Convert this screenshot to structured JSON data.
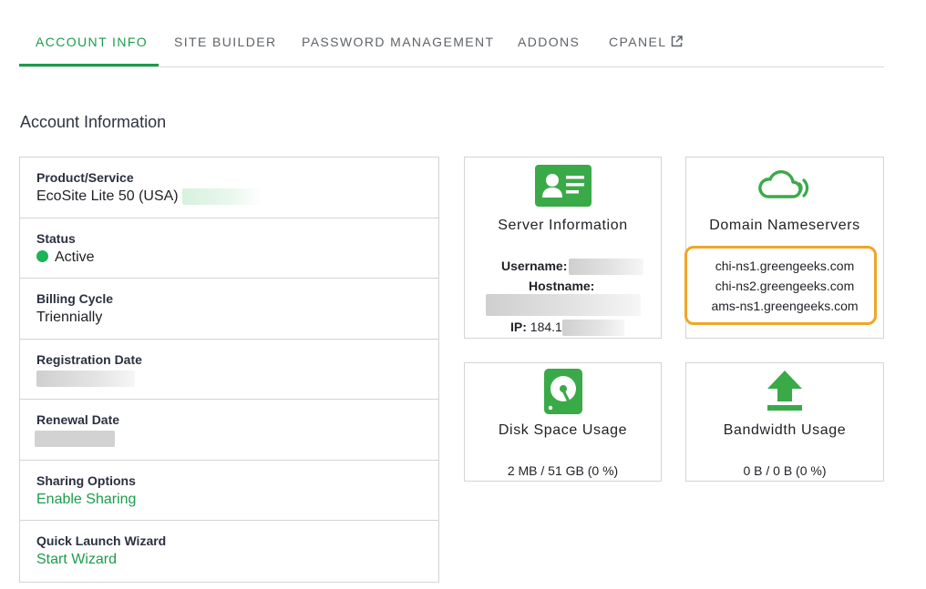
{
  "tabs": [
    {
      "label": "ACCOUNT INFO",
      "active": true
    },
    {
      "label": "SITE BUILDER",
      "active": false
    },
    {
      "label": "PASSWORD MANAGEMENT",
      "active": false
    },
    {
      "label": "ADDONS",
      "active": false
    },
    {
      "label": "CPANEL",
      "active": false,
      "icon": "external-link-icon"
    }
  ],
  "section_title": "Account Information",
  "info": {
    "product": {
      "label": "Product/Service",
      "value": "EcoSite Lite 50 (USA)"
    },
    "status": {
      "label": "Status",
      "value": "Active",
      "color": "#1db356"
    },
    "billing": {
      "label": "Billing Cycle",
      "value": "Triennially"
    },
    "registration": {
      "label": "Registration Date"
    },
    "renewal": {
      "label": "Renewal Date"
    },
    "sharing": {
      "label": "Sharing Options",
      "link": "Enable Sharing"
    },
    "wizard": {
      "label": "Quick Launch Wizard",
      "link": "Start Wizard"
    }
  },
  "server": {
    "title": "Server Information",
    "icon": "id-card-icon",
    "username_label": "Username:",
    "hostname_label": "Hostname:",
    "ip_label": "IP:",
    "ip_value": "184.1"
  },
  "nameservers": {
    "title": "Domain Nameservers",
    "icon": "cloud-signal-icon",
    "list": [
      "chi-ns1.greengeeks.com",
      "chi-ns2.greengeeks.com",
      "ams-ns1.greengeeks.com"
    ],
    "highlight_color": "#f0a626"
  },
  "disk": {
    "title": "Disk Space Usage",
    "icon": "hard-drive-icon",
    "value": "2 MB / 51 GB (0 %)"
  },
  "bandwidth": {
    "title": "Bandwidth Usage",
    "icon": "upload-arrow-icon",
    "value": "0 B / 0 B (0 %)"
  },
  "colors": {
    "accent": "#1a9d4a",
    "icon_green": "#3aaa49"
  }
}
